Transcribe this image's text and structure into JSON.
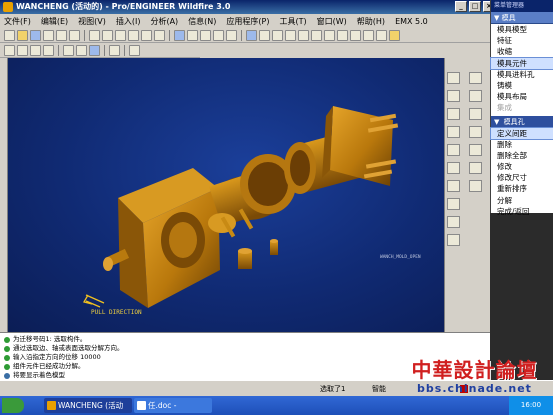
{
  "window": {
    "title": "WANCHENG (活动的) - Pro/ENGINEER Wildfire 3.0"
  },
  "menu": [
    "文件(F)",
    "编辑(E)",
    "视图(V)",
    "插入(I)",
    "分析(A)",
    "信息(N)",
    "应用程序(P)",
    "工具(T)",
    "窗口(W)",
    "帮助(H)",
    "EMX 5.0"
  ],
  "viewport": {
    "pull_direction_label": "PULL DIRECTION",
    "part_tag": "WANCH_MOLD_OPEN",
    "background_color": "#102a73",
    "model_color": "#c8860c"
  },
  "panel": {
    "title": "菜单管理器",
    "header": "模具",
    "items": [
      {
        "label": "模具模型",
        "state": "normal"
      },
      {
        "label": "特征",
        "state": "normal"
      },
      {
        "label": "收缩",
        "state": "normal"
      },
      {
        "label": "模具元件",
        "state": "selected"
      },
      {
        "label": "模具进料孔",
        "state": "normal"
      },
      {
        "label": "铸模",
        "state": "normal"
      },
      {
        "label": "模具布局",
        "state": "normal"
      },
      {
        "label": "集成",
        "state": "disabled"
      }
    ],
    "sub_header": "模具孔",
    "sub_items": [
      {
        "label": "定义间距",
        "state": "selected"
      },
      {
        "label": "删除",
        "state": "normal"
      },
      {
        "label": "删除全部",
        "state": "normal"
      },
      {
        "label": "修改",
        "state": "normal"
      },
      {
        "label": "修改尺寸",
        "state": "normal"
      },
      {
        "label": "重新排序",
        "state": "normal"
      },
      {
        "label": "分解",
        "state": "normal"
      },
      {
        "label": "完成/返回",
        "state": "normal"
      }
    ]
  },
  "messages": [
    "为迁移号码1: 选取构件。",
    "通过选取边、轴或表面选取分解方向。",
    "输入沿指定方向的位移  10000",
    "组件元件已经成功分解。",
    "将要显示着色模型"
  ],
  "status": {
    "selection": "选取了1",
    "mode": "智能"
  },
  "watermark": {
    "cn": "中華設計論壇",
    "url": "bbs.chinade.net"
  },
  "taskbar": {
    "tasks": [
      "WANCHENG (活动的) ...",
      "任.doc - Microsoft Word"
    ],
    "clock": "16:00"
  }
}
